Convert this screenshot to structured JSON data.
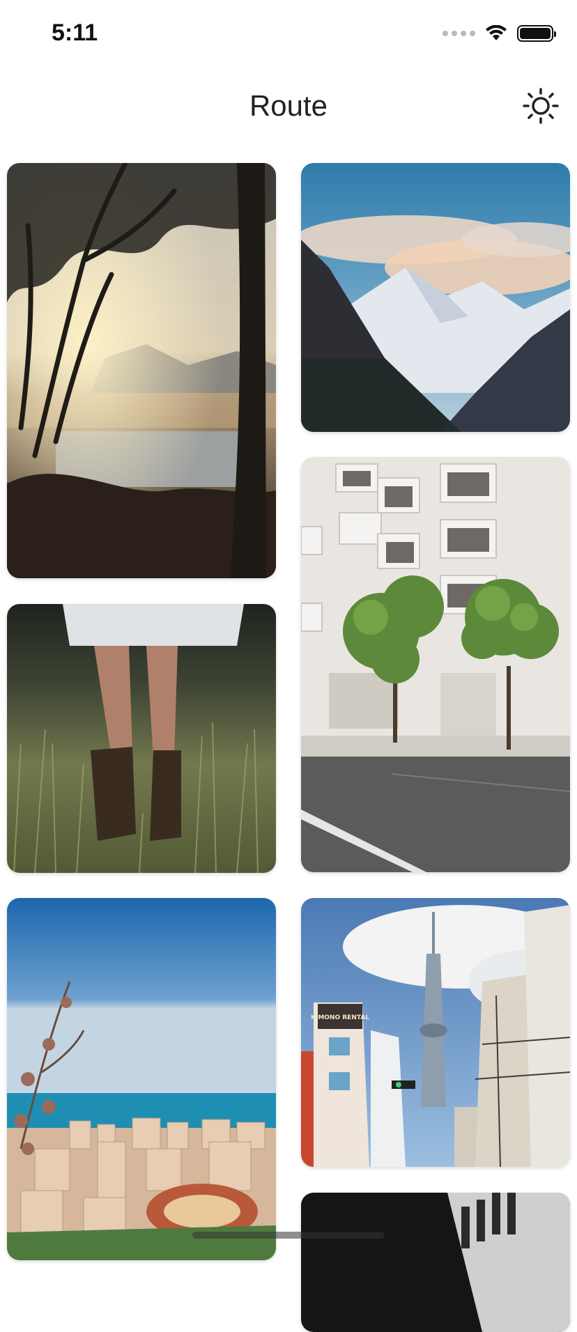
{
  "status_bar": {
    "time": "5:11"
  },
  "nav": {
    "title": "Route",
    "theme_icon": "sun-icon"
  },
  "gallery": {
    "photos": [
      "forest-sunrise-lake",
      "snowy-mountain-clouds",
      "grass-legs-boots",
      "white-building-street-trees",
      "coastal-city-sea",
      "tokyo-skytree-street",
      "black-white-building"
    ],
    "sign_text": "KIMONO RENTAL"
  }
}
